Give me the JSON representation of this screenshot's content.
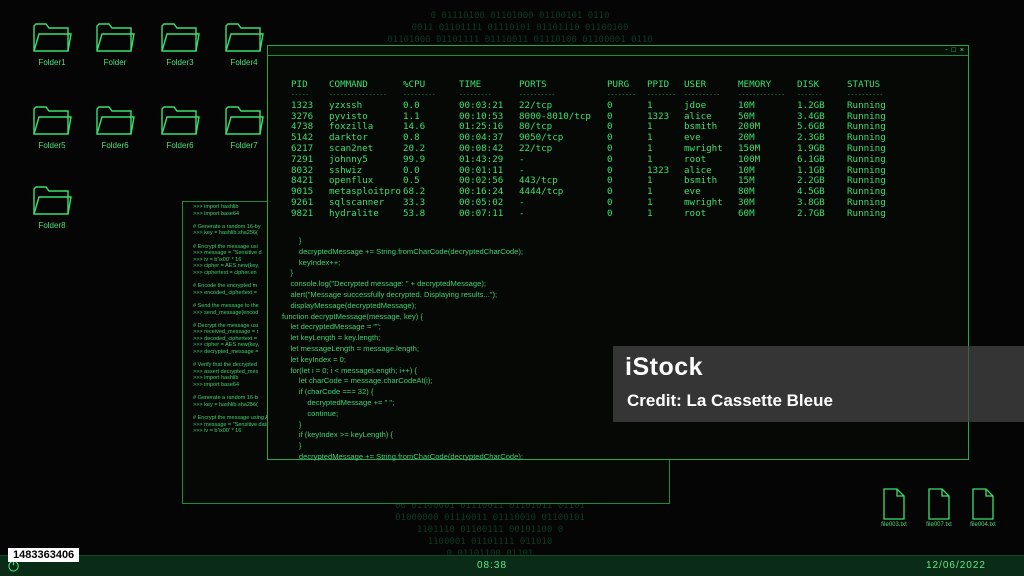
{
  "background": {
    "binary_top": [
      "0 01110100 01101000 01100101 0110",
      "0011 01101111 01110101 01101110 01100100",
      "01101000 01101111 01110011 01110100 01100001 0110"
    ],
    "binary_bottom": [
      "00 01100001 01110011 01101011 01101",
      "01000000 01110011 01110010 01100101",
      "1101110 01100111 00101100 0",
      "1100001 01101111 011010",
      "0 01101100 01101"
    ]
  },
  "desktop": {
    "folders": [
      {
        "label": "Folder1"
      },
      {
        "label": "Folder"
      },
      {
        "label": "Folder3"
      },
      {
        "label": "Folder4"
      },
      {
        "label": "Folder5"
      },
      {
        "label": "Folder6"
      },
      {
        "label": "Folder6"
      },
      {
        "label": "Folder7"
      },
      {
        "label": "Folder8"
      }
    ],
    "files": [
      {
        "label": "file003.txt"
      },
      {
        "label": "file007.txt"
      },
      {
        "label": "file004.txt"
      }
    ]
  },
  "back_window": {
    "code": [
      ">>> import hashlib",
      ">>> import base64",
      "",
      "# Generate a random 16-by",
      ">>> key = hashlib.sha256(",
      "",
      "# Encrypt the message usi",
      ">>> message = \"Sensitive d",
      ">>> iv = b'\\x00' * 16",
      ">>> cipher = AES.new(key,",
      ">>> ciphertext = cipher.en",
      "",
      "# Encode the encrypted m",
      ">>> encoded_ciphertext =",
      "",
      "# Send the message to the",
      ">>> send_message(encod",
      "",
      "# Decrypt the message usi",
      ">>> received_message = r",
      ">>> decoded_ciphertext =",
      ">>> cipher = AES.new(key,",
      ">>> decrypted_message =",
      "",
      "# Verify that the decrypted",
      ">>> assert decrypted_mes",
      ">>> import hashlib",
      ">>> import base64",
      "",
      "# Generate a random 16-b",
      ">>> key = hashlib.sha256(",
      "",
      "# Encrypt the message using AES-256 in CBC mode",
      ">>> message = \"Sensitive data that needs to be kept secret\"",
      ">>> iv = b'\\x00' * 16"
    ]
  },
  "terminal": {
    "columns": [
      "PID",
      "COMMAND",
      "%CPU",
      "TIME",
      "PORTS",
      "PURG",
      "PPID",
      "USER",
      "MEMORY",
      "DISK",
      "STATUS"
    ],
    "dashes": [
      "-----",
      "----------------",
      "---------",
      "---------",
      "----------",
      "--------",
      "--------",
      "----------",
      "-------------",
      "-------",
      "----------"
    ],
    "rows": [
      [
        "1323",
        "yzxssh",
        "0.0",
        "00:03:21",
        "22/tcp",
        "0",
        "1",
        "jdoe",
        "10M",
        "1.2GB",
        "Running"
      ],
      [
        "3276",
        "pyvisto",
        "1.1",
        "00:10:53",
        "8000-8010/tcp",
        "0",
        "1323",
        "alice",
        "50M",
        "3.4GB",
        "Running"
      ],
      [
        "4738",
        "foxzilla",
        "14.6",
        "01:25:16",
        "80/tcp",
        "0",
        "1",
        "bsmith",
        "200M",
        "5.6GB",
        "Running"
      ],
      [
        "5142",
        "darktor",
        "0.8",
        "00:04:37",
        "9050/tcp",
        "0",
        "1",
        "eve",
        "20M",
        "2.3GB",
        "Running"
      ],
      [
        "6217",
        "scan2net",
        "20.2",
        "00:08:42",
        "22/tcp",
        "0",
        "1",
        "mwright",
        "150M",
        "1.9GB",
        "Running"
      ],
      [
        "7291",
        "johnny5",
        "99.9",
        "01:43:29",
        "-",
        "0",
        "1",
        "root",
        "100M",
        "6.1GB",
        "Running"
      ],
      [
        "8032",
        "sshwiz",
        "0.0",
        "00:01:11",
        "-",
        "0",
        "1323",
        "alice",
        "10M",
        "1.1GB",
        "Running"
      ],
      [
        "8421",
        "openflux",
        "0.5",
        "00:02:56",
        "443/tcp",
        "0",
        "1",
        "bsmith",
        "15M",
        "2.2GB",
        "Running"
      ],
      [
        "9015",
        "metasploitpro",
        "68.2",
        "00:16:24",
        "4444/tcp",
        "0",
        "1",
        "eve",
        "80M",
        "4.5GB",
        "Running"
      ],
      [
        "9261",
        "sqlscanner",
        "33.3",
        "00:05:02",
        "-",
        "0",
        "1",
        "mwright",
        "30M",
        "3.8GB",
        "Running"
      ],
      [
        "9821",
        "hydralite",
        "53.8",
        "00:07:11",
        "-",
        "0",
        "1",
        "root",
        "60M",
        "2.7GB",
        "Running"
      ]
    ],
    "code": [
      "        }",
      "        decryptedMessage += String.fromCharCode(decryptedCharCode);",
      "        keyIndex++;",
      "    }",
      "    console.log(\"Decrypted message: \" + decryptedMessage);",
      "    alert(\"Message successfully decrypted. Displaying results...\");",
      "    displayMessage(decryptedMessage);",
      "function decryptMessage(message, key) {",
      "    let decryptedMessage = \"\";",
      "    let keyLength = key.length;",
      "    let messageLength = message.length;",
      "    let keyIndex = 0;",
      "    for(let i = 0; i < messageLength; i++) {",
      "        let charCode = message.charCodeAt(i);",
      "        if (charCode === 32) {",
      "            decryptedMessage += \" \";",
      "            continue;",
      "        }",
      "        if (keyIndex >= keyLength) {",
      "        }",
      "        decryptedMessage += String.fromCharCode(decryptedCharCode);"
    ],
    "controls": {
      "minimize": "-",
      "maximize": "□",
      "close": "×"
    }
  },
  "taskbar": {
    "power_glyph": "⏻",
    "time": "08:38",
    "date": "12/06/2022"
  },
  "watermark": {
    "logo": "iStock",
    "credit": "Credit: La Cassette Bleue",
    "image_id": "1483363406"
  },
  "colors": {
    "accent_green": "#3be06f",
    "border_green": "#1b8a45",
    "taskbar_bg": "#0a2c17"
  }
}
